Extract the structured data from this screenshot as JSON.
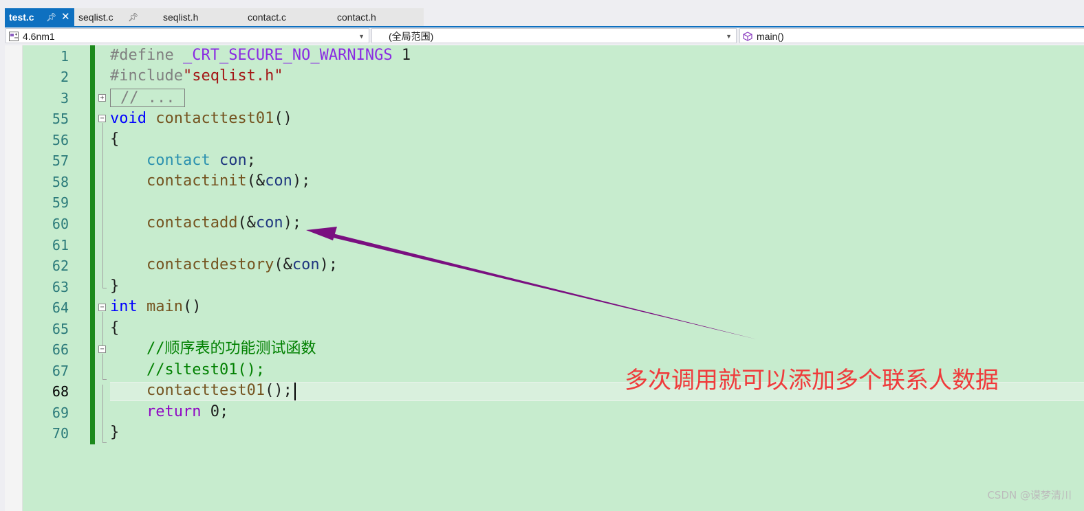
{
  "tabs": [
    {
      "label": "test.c",
      "pin": "を",
      "close": "✕",
      "active": true
    },
    {
      "label": "seqlist.c",
      "pin": "を"
    },
    {
      "label": "seqlist.h"
    },
    {
      "label": "contact.c"
    },
    {
      "label": "contact.h"
    }
  ],
  "nav": {
    "project": "4.6nm1",
    "scope": "(全局范围)",
    "member": "main()"
  },
  "lines": [
    "1",
    "2",
    "3",
    "55",
    "56",
    "57",
    "58",
    "59",
    "60",
    "61",
    "62",
    "63",
    "64",
    "65",
    "66",
    "67",
    "68",
    "69",
    "70"
  ],
  "code": {
    "l1_define": "#define",
    "l1_macro": "_CRT_SECURE_NO_WARNINGS",
    "l1_val": "1",
    "l2_include": "#include",
    "l2_file": "\"seqlist.h\"",
    "l3_collapsed": "// ...",
    "l55_void": "void",
    "l55_name": "contacttest01",
    "l55_paren": "()",
    "l56": "{",
    "l57_type": "contact",
    "l57_var": "con",
    "l58_fn": "contactinit",
    "l58_var": "con",
    "l60_fn": "contactadd",
    "l60_var": "con",
    "l62_fn": "contactdestory",
    "l62_var": "con",
    "l63": "}",
    "l64_int": "int",
    "l64_name": "main",
    "l64_paren": "()",
    "l65": "{",
    "l66_comment": "//顺序表的功能测试函数",
    "l67_comment": "//sltest01();",
    "l68_fn": "contacttest01",
    "l69_return": "return",
    "l69_val": "0",
    "l70": "}"
  },
  "annotation": "多次调用就可以添加多个联系人数据",
  "watermark": "CSDN @谟梦清川",
  "colors": {
    "editor_bg": "#c7ecce",
    "change_bar": "#1c8a1c",
    "active_tab": "#0e70c0",
    "annotation": "#ef3b3b",
    "arrow": "#7a0f80"
  }
}
